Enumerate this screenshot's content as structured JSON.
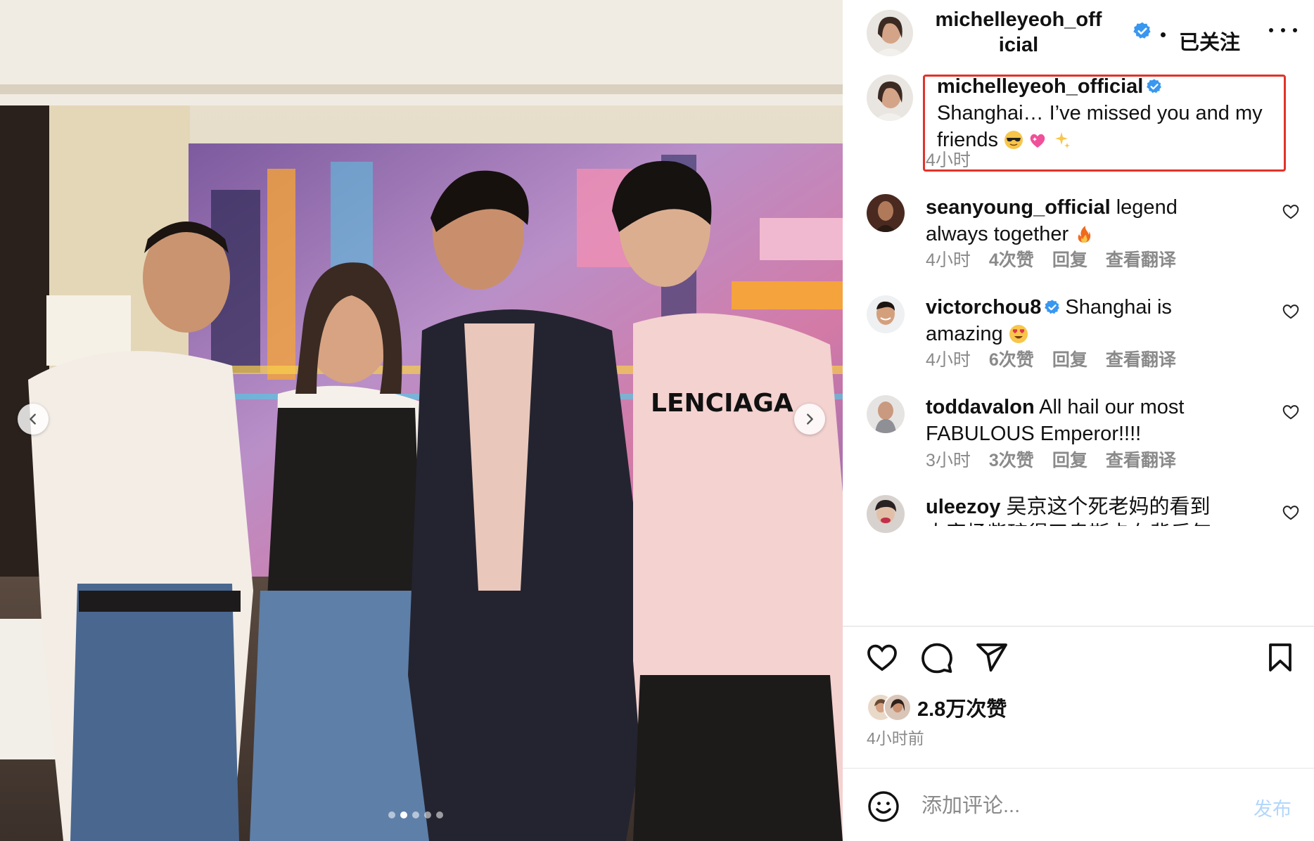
{
  "post": {
    "username": "michelleyeoh_official",
    "follow_status": "已关注",
    "caption_user": "michelleyeoh_official",
    "caption_text": "Shanghai… I’ve missed you and my friends",
    "caption_emojis": [
      "smiling-face-with-sunglasses",
      "sparkling-heart",
      "sparkles"
    ],
    "caption_time": "4小时",
    "likes": "2.8万次赞",
    "posted_ago": "4小时前",
    "carousel": {
      "total": 5,
      "active": 2
    },
    "photo_text": "LENCIAGA"
  },
  "comments": [
    {
      "user": "seanyoung_official",
      "verified": false,
      "text": "legend always together",
      "emoji": "fire",
      "time": "4小时",
      "likes": "4次赞",
      "reply": "回复",
      "translate": "查看翻译"
    },
    {
      "user": "victorchou8",
      "verified": true,
      "text": "Shanghai is amazing",
      "emoji": "heart-eyes",
      "time": "4小时",
      "likes": "6次赞",
      "reply": "回复",
      "translate": "查看翻译"
    },
    {
      "user": "toddavalon",
      "verified": false,
      "text": "All hail our most FABULOUS Emperor!!!!",
      "emoji": "",
      "time": "3小时",
      "likes": "3次赞",
      "reply": "回复",
      "translate": "查看翻译"
    },
    {
      "user": "uleezoy",
      "verified": false,
      "text": "吴京这个死老妈的看到人家杨紫琼得了奥斯卡在背后气得跳",
      "emoji": ""
    }
  ],
  "comment_bar": {
    "placeholder": "添加评论...",
    "post_label": "发布"
  },
  "colors": {
    "verified": "#3897f0",
    "highlight": "#e0332b",
    "meta": "#8a8a8a",
    "post_disabled": "#b3d6fb"
  }
}
